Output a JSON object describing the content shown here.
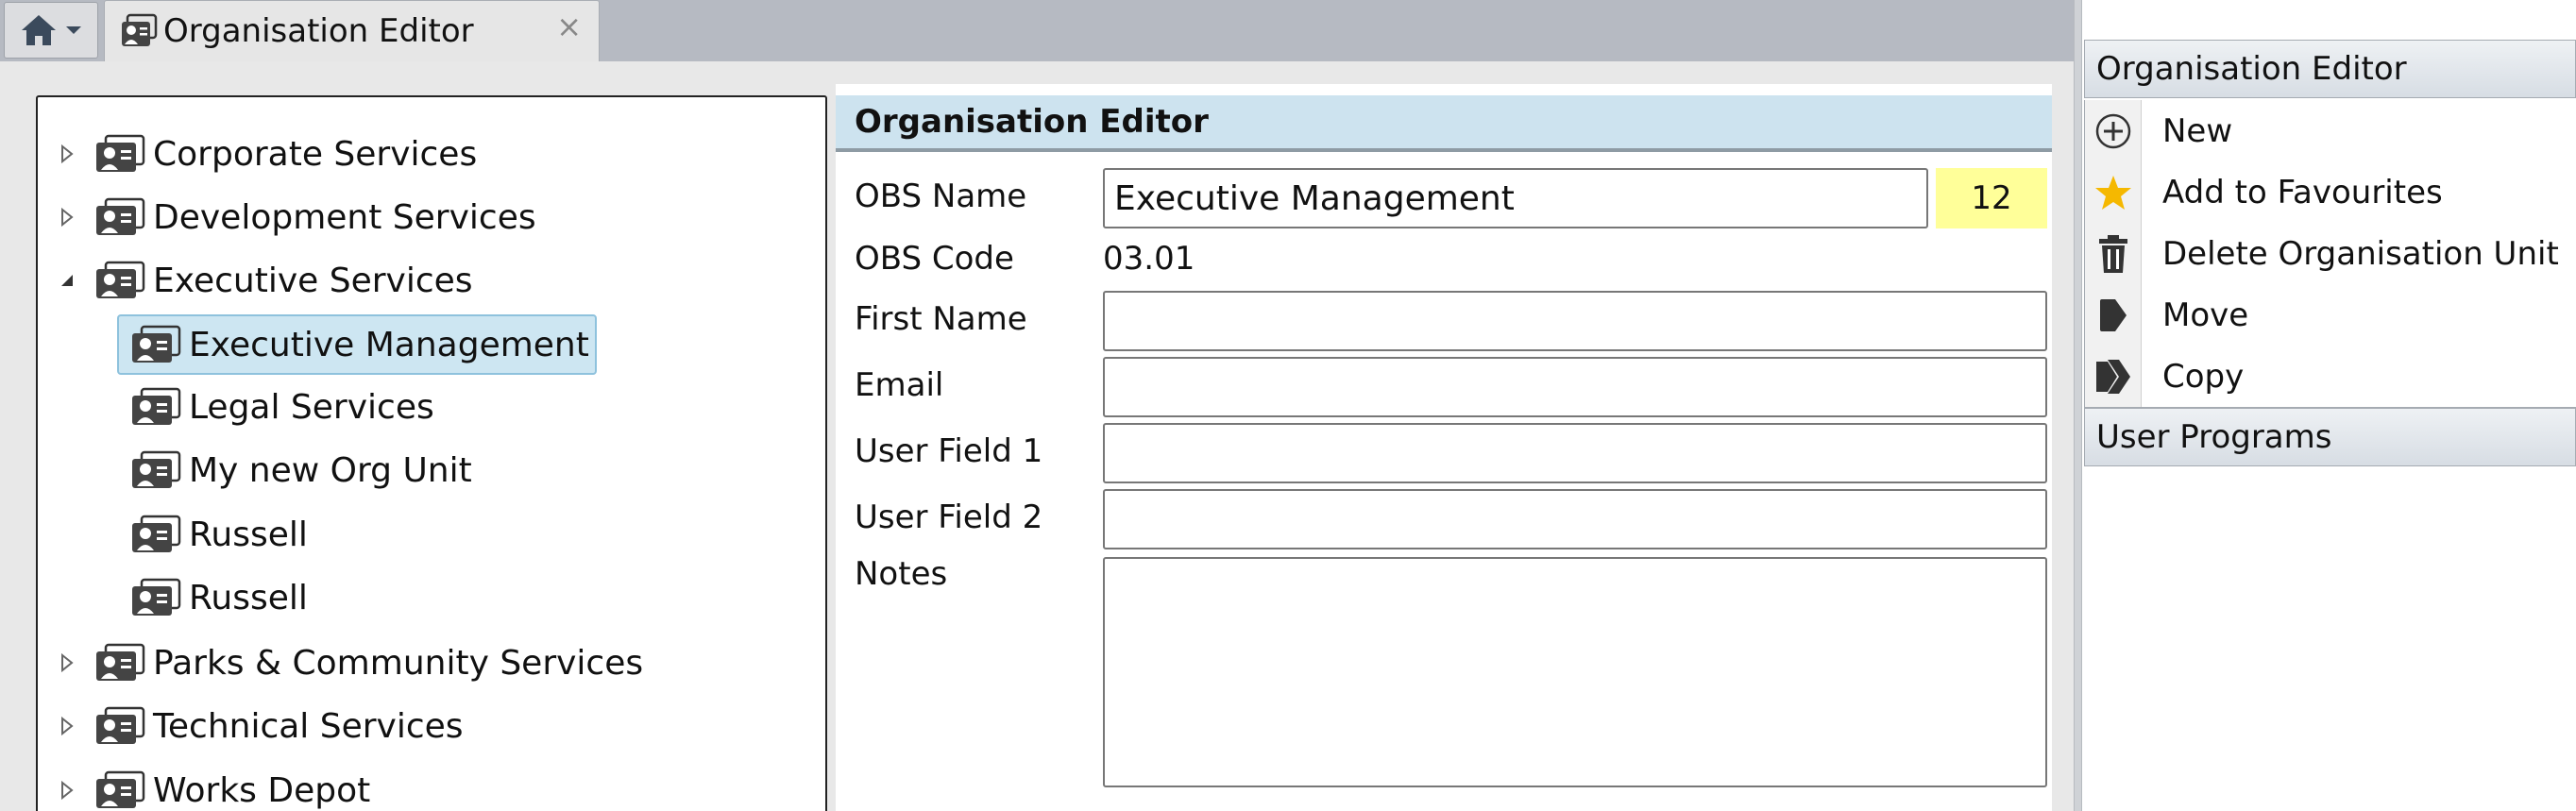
{
  "tab": {
    "title": "Organisation Editor",
    "close": "×"
  },
  "tree": {
    "items": [
      {
        "label": "Corporate Services"
      },
      {
        "label": "Development Services"
      },
      {
        "label": "Executive Services"
      },
      {
        "label": "Executive Management"
      },
      {
        "label": "Legal Services"
      },
      {
        "label": "My new Org Unit"
      },
      {
        "label": "Russell"
      },
      {
        "label": "Russell"
      },
      {
        "label": "Parks & Community Services"
      },
      {
        "label": "Technical Services"
      },
      {
        "label": "Works Depot"
      }
    ]
  },
  "editor": {
    "header": "Organisation Editor",
    "fields": {
      "obs_name": {
        "label": "OBS Name",
        "value": "Executive Management",
        "count": "12"
      },
      "obs_code": {
        "label": "OBS Code",
        "value": "03.01"
      },
      "first_name": {
        "label": "First Name",
        "value": ""
      },
      "email": {
        "label": "Email",
        "value": ""
      },
      "user_field_1": {
        "label": "User Field 1",
        "value": ""
      },
      "user_field_2": {
        "label": "User Field 2",
        "value": ""
      },
      "notes": {
        "label": "Notes",
        "value": ""
      }
    }
  },
  "right_panel": {
    "title": "Organisation Editor",
    "actions": [
      {
        "label": "New",
        "icon": "plus-circle-icon"
      },
      {
        "label": "Add to Favourites",
        "icon": "star-icon"
      },
      {
        "label": "Delete Organisation Unit",
        "icon": "trash-icon"
      },
      {
        "label": "Move",
        "icon": "move-icon"
      },
      {
        "label": "Copy",
        "icon": "copy-icon"
      }
    ],
    "section2_title": "User Programs"
  },
  "colors": {
    "tab_bar": "#b6bac2",
    "selection": "#cde6f2",
    "editor_header": "#cde3ef",
    "count_highlight": "#ffff99",
    "star": "#f5b800"
  }
}
